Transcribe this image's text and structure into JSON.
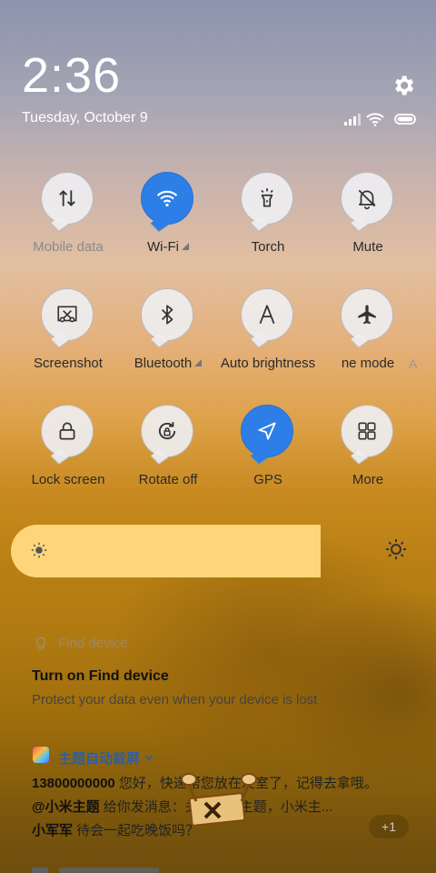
{
  "status": {
    "time": "2:36",
    "date": "Tuesday, October 9",
    "icons": [
      "signal-icon",
      "wifi-icon",
      "battery-icon"
    ]
  },
  "header": {
    "settings_icon": "gear-icon"
  },
  "tiles": [
    {
      "label": "Mobile data",
      "icon": "data-arrows-icon",
      "active": false,
      "dim": true
    },
    {
      "label": "Wi-Fi",
      "icon": "wifi-icon",
      "active": true,
      "caret": true
    },
    {
      "label": "Torch",
      "icon": "torch-icon",
      "active": false
    },
    {
      "label": "Mute",
      "icon": "bell-off-icon",
      "active": false
    },
    {
      "label": "Screenshot",
      "icon": "scissors-icon",
      "active": false
    },
    {
      "label": "Bluetooth",
      "icon": "bluetooth-icon",
      "active": false,
      "caret": true
    },
    {
      "label": "Auto brightness",
      "icon": "auto-brightness-icon",
      "active": false
    },
    {
      "label": "ne mode",
      "icon": "airplane-icon",
      "active": false
    },
    {
      "label": "Lock screen",
      "icon": "lock-icon",
      "active": false
    },
    {
      "label": "Rotate off",
      "icon": "rotate-lock-icon",
      "active": false
    },
    {
      "label": "GPS",
      "icon": "navigation-icon",
      "active": true
    },
    {
      "label": "More",
      "icon": "grid-icon",
      "active": false
    }
  ],
  "brightness": {
    "level": 0.71
  },
  "notifications": [
    {
      "app": "Find device",
      "title": "Turn on Find device",
      "body": "Protect your data even when your device is lost"
    },
    {
      "app": "主题自动截屏",
      "messages": [
        {
          "sender": "13800000000",
          "text": " 您好，快递帮您放在发室了，记得去拿哦。"
        },
        {
          "sender": "@小米主题",
          "text": " 给你发消息：关注小米主题，小米主..."
        },
        {
          "sender": "小军军",
          "text": " 待会一起吃晚饭吗？"
        }
      ],
      "badge": "+1"
    }
  ],
  "colors": {
    "accent": "#2d7ee6",
    "slider": "#ffd57a"
  }
}
